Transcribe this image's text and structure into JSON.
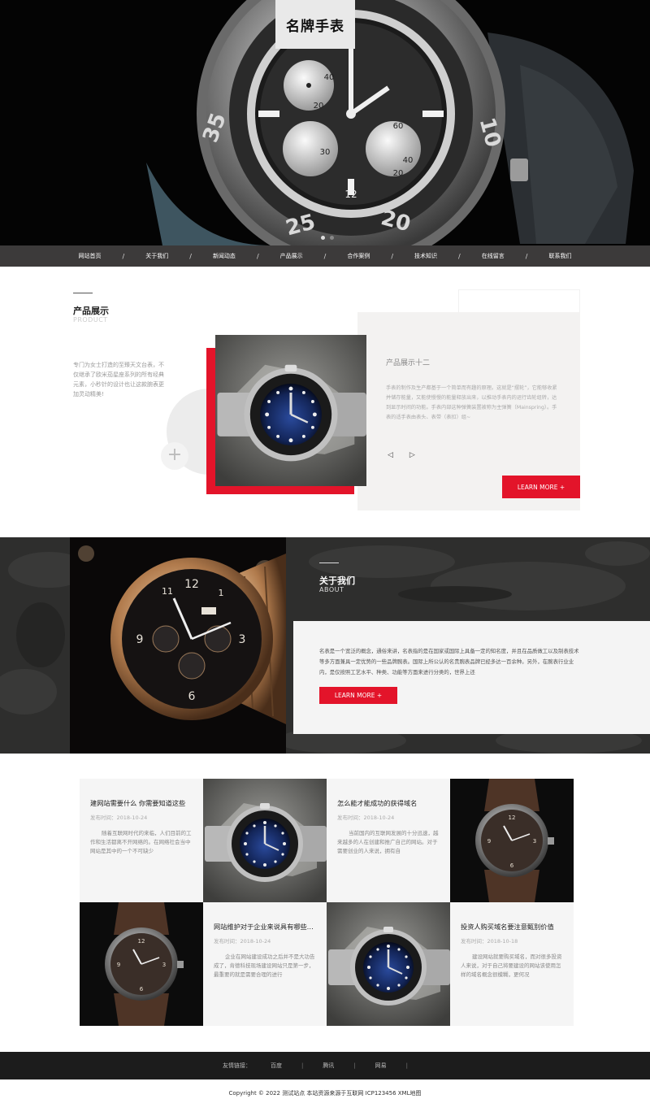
{
  "site": {
    "logo_text": "名牌手表"
  },
  "nav": {
    "items": [
      "网站首页",
      "关于我们",
      "新闻动态",
      "产品展示",
      "合作案例",
      "技术知识",
      "在线留言",
      "联系我们"
    ],
    "separator": "/"
  },
  "products": {
    "title": "产品展示",
    "subtitle": "PRODUCT",
    "description": "专门为女士打造的至臻天文台表，不仅继承了欧米茄星座系列的所有经典元素，小秒针的设计也让这款腕表更加灵动精美!",
    "plus_glyph": "+",
    "item_title": "产品展示十二",
    "item_text": "手表的制作及生产都基于一个简单而有趣的原理。这就是“摆轮”，它能够收紧并储存能量，又能使慢慢的能量释放出来，以推动手表内的运行齿轮组转，达到显示时间的功能。手表内部这种弹簧装置被称为主弹簧（Mainspring）。手表的适手表由表头、表带（表扣）组~",
    "prev_glyph": "◁",
    "next_glyph": "▷",
    "more_label": "LEARN MORE +"
  },
  "about": {
    "title": "关于我们",
    "subtitle": "ABOUT",
    "text": "名表是一个宽泛的概念，通俗来讲，名表指的是在国家或国际上具备一定的知名度，并且在品质做工以及制表技术等多方面兼具一定优势的一些品牌腕表。国际上所公认的名贵腕表品牌已经多达一百余种。另外，在腕表行业业内，是仅按照工艺水平、种类、功能等方面来进行分类的，世界上还",
    "more_label": "LEARN MORE +"
  },
  "news": [
    {
      "title": "建网站需要什么 你需要知道这些",
      "date_label": "发布时间：",
      "date": "2018-10-24",
      "excerpt": "随着互联网时代的来临，人们目前的工作和生活都离不开网络的。在网络社会当中网站是其中的一个不可缺少"
    },
    {
      "title": "怎么能才能成功的获得域名",
      "date_label": "发布时间：",
      "date": "2018-10-24",
      "excerpt": "当前国内的互联网发展的十分迅速，越来越多的人在创建和推广自己的网站。对于需要创业的人来说，拥有自"
    },
    {
      "title": "网站维护对于企业来说具有哪些作用",
      "date_label": "发布时间：",
      "date": "2018-10-24",
      "excerpt": "企业在网站建设成功之后并不是大功告成了，肯德科技现场建设网站只是第一步，最重要的就是需要合理的进行"
    },
    {
      "title": "投资人购买域名要注意甄别价值",
      "date_label": "发布时间：",
      "date": "2018-10-18",
      "excerpt": "建设网站就要购买域名，而对很多投资人来说，对于自己将要建设的网站该使用怎样的域名概念很模糊，更何况"
    }
  ],
  "footer": {
    "links_label": "友情链接：",
    "links": [
      "百度",
      "腾讯",
      "网易"
    ],
    "separator": "|",
    "copyright": "Copyright © 2022 测试站点 本站资源来源于互联网 ICP123456 XML地图"
  }
}
